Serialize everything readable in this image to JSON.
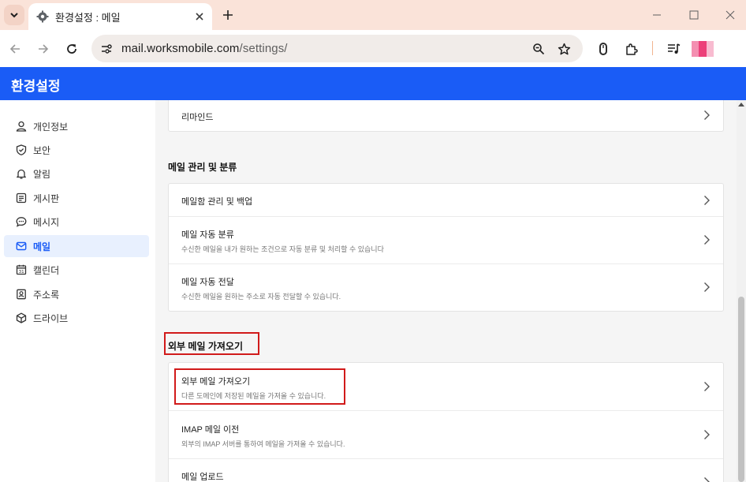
{
  "browser": {
    "tab_title": "환경설정 : 메일",
    "url_host": "mail.worksmobile.com",
    "url_path": "/settings/",
    "profile_colors": [
      "#f48fb1",
      "#ec407a",
      "#f8bbd0"
    ]
  },
  "app": {
    "title": "환경설정",
    "accent_color": "#1a5cf6"
  },
  "sidebar": {
    "items": [
      {
        "label": "개인정보",
        "icon": "person-icon",
        "active": false
      },
      {
        "label": "보안",
        "icon": "shield-icon",
        "active": false
      },
      {
        "label": "알림",
        "icon": "bell-icon",
        "active": false
      },
      {
        "label": "게시판",
        "icon": "board-icon",
        "active": false
      },
      {
        "label": "메시지",
        "icon": "chat-icon",
        "active": false
      },
      {
        "label": "메일",
        "icon": "mail-icon",
        "active": true
      },
      {
        "label": "캘린더",
        "icon": "calendar-icon",
        "active": false
      },
      {
        "label": "주소록",
        "icon": "contacts-icon",
        "active": false
      },
      {
        "label": "드라이브",
        "icon": "drive-icon",
        "active": false
      }
    ]
  },
  "main": {
    "top_card": {
      "rows": [
        {
          "title": "리마인드"
        }
      ]
    },
    "sections": [
      {
        "title": "메일 관리 및 분류",
        "rows": [
          {
            "title": "메일함 관리 및 백업",
            "desc": ""
          },
          {
            "title": "메일 자동 분류",
            "desc": "수신한 메일을 내가 원하는 조건으로 자동 분류 및 처리할 수 있습니다"
          },
          {
            "title": "메일 자동 전달",
            "desc": "수신한 메일을 원하는 주소로 자동 전달할 수 있습니다."
          }
        ]
      },
      {
        "title": "외부 메일 가져오기",
        "rows": [
          {
            "title": "외부 메일 가져오기",
            "desc": "다른 도메인에 저장된 메일을 가져올 수 있습니다."
          },
          {
            "title": "IMAP 메일 이전",
            "desc": "외부의 IMAP 서버를 통하여 메일을 가져올 수 있습니다."
          },
          {
            "title": "메일 업로드",
            "desc": ""
          }
        ]
      }
    ],
    "highlight_color": "#d11a1a"
  }
}
